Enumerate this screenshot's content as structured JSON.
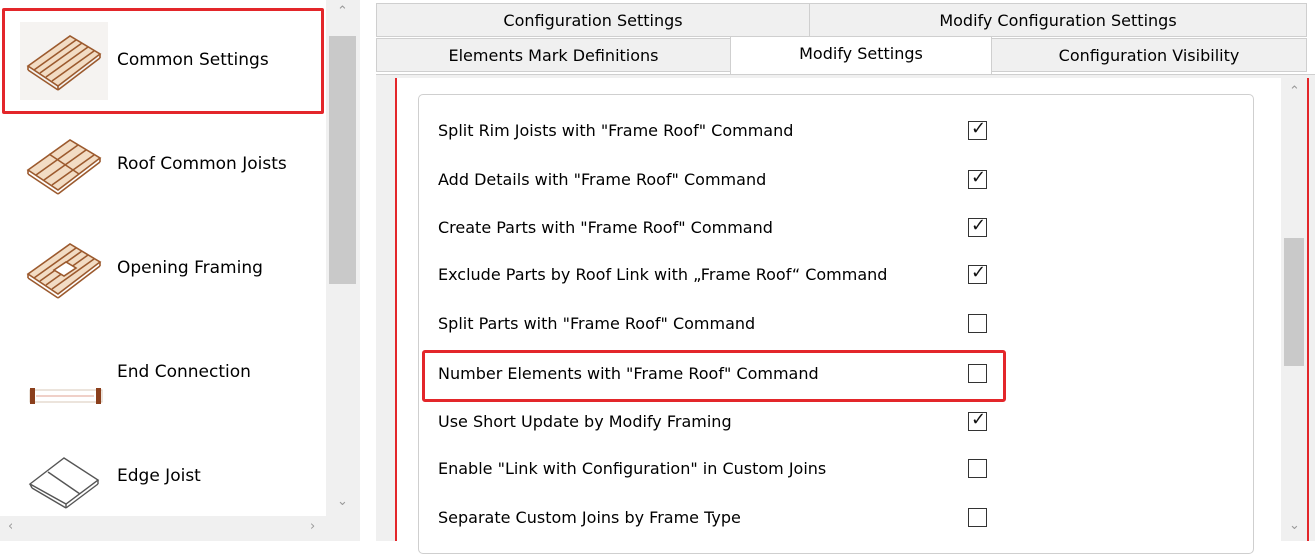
{
  "sidebar": {
    "items": [
      {
        "label": "Common Settings",
        "icon": "common-settings-icon",
        "selected": true
      },
      {
        "label": "Roof Common Joists",
        "icon": "roof-common-joists-icon",
        "selected": false
      },
      {
        "label": "Opening Framing",
        "icon": "opening-framing-icon",
        "selected": false
      },
      {
        "label": "End Connection",
        "icon": "end-connection-icon",
        "selected": false
      },
      {
        "label": "Edge Joist",
        "icon": "edge-joist-icon",
        "selected": false
      }
    ]
  },
  "tabs": {
    "row1": [
      {
        "label": "Configuration Settings"
      },
      {
        "label": "Modify Configuration Settings"
      }
    ],
    "row2": [
      {
        "label": "Elements Mark Definitions"
      },
      {
        "label": "Modify Settings",
        "active": true
      },
      {
        "label": "Configuration Visibility"
      }
    ]
  },
  "settings": [
    {
      "label": "Split Rim Joists with \"Frame Roof\" Command",
      "checked": true
    },
    {
      "label": "Add Details with \"Frame Roof\" Command",
      "checked": true
    },
    {
      "label": "Create Parts with \"Frame Roof\" Command",
      "checked": true
    },
    {
      "label": "Exclude Parts by Roof Link with „Frame Roof“ Command",
      "checked": true
    },
    {
      "label": "Split Parts with \"Frame Roof\" Command",
      "checked": false
    },
    {
      "label": "Number Elements with \"Frame Roof\" Command",
      "checked": false,
      "highlighted": true
    },
    {
      "label": "Use Short Update by Modify Framing",
      "checked": true
    },
    {
      "label": "Enable \"Link with Configuration\" in Custom Joins",
      "checked": false
    },
    {
      "label": "Separate Custom Joins by Frame Type",
      "checked": false
    }
  ],
  "colors": {
    "highlight": "#e3262a",
    "wood": "#a0522d",
    "panel": "#f0f0f0"
  }
}
